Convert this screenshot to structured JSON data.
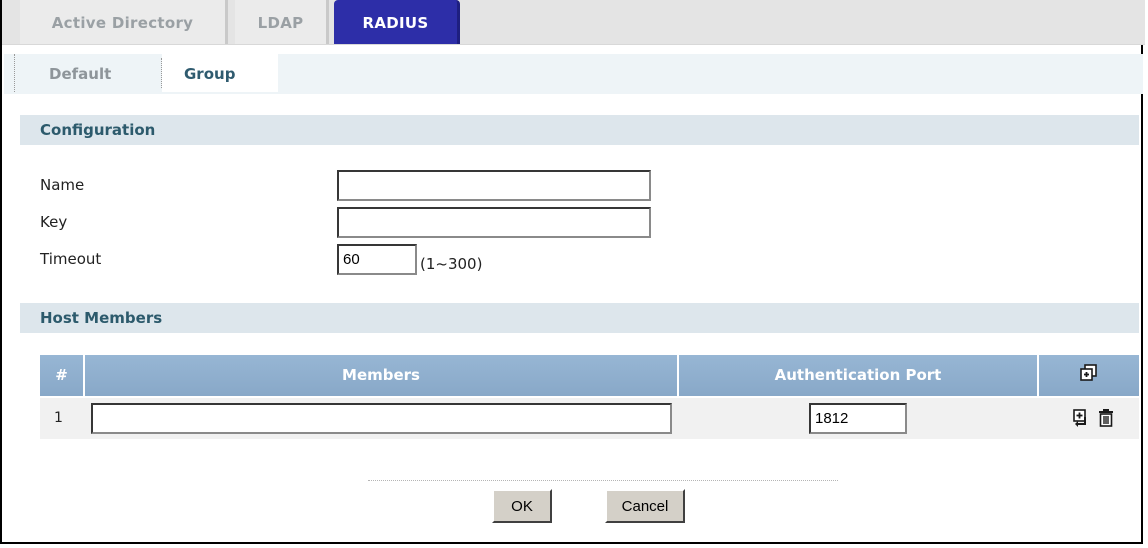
{
  "tabs": [
    {
      "label": "Active Directory",
      "active": false
    },
    {
      "label": "LDAP",
      "active": false
    },
    {
      "label": "RADIUS",
      "active": true
    }
  ],
  "subtabs": [
    {
      "label": "Default",
      "active": false
    },
    {
      "label": "Group",
      "active": true
    }
  ],
  "configuration": {
    "header": "Configuration",
    "name_label": "Name",
    "name_value": "",
    "key_label": "Key",
    "key_value": "",
    "timeout_label": "Timeout",
    "timeout_value": "60",
    "timeout_range": "(1~300)"
  },
  "host_members": {
    "header": "Host Members",
    "columns": [
      "#",
      "Members",
      "Authentication Port"
    ],
    "rows": [
      {
        "index": "1",
        "member": "",
        "port": "1812"
      }
    ],
    "icons": {
      "add_header": "add-icon",
      "add_row": "insert-icon",
      "delete_row": "trash-icon"
    }
  },
  "buttons": {
    "ok": "OK",
    "cancel": "Cancel"
  },
  "colors": {
    "active_tab": "#2d2ea8",
    "section_bg": "#dde6ec",
    "table_header": "#8faecd"
  }
}
